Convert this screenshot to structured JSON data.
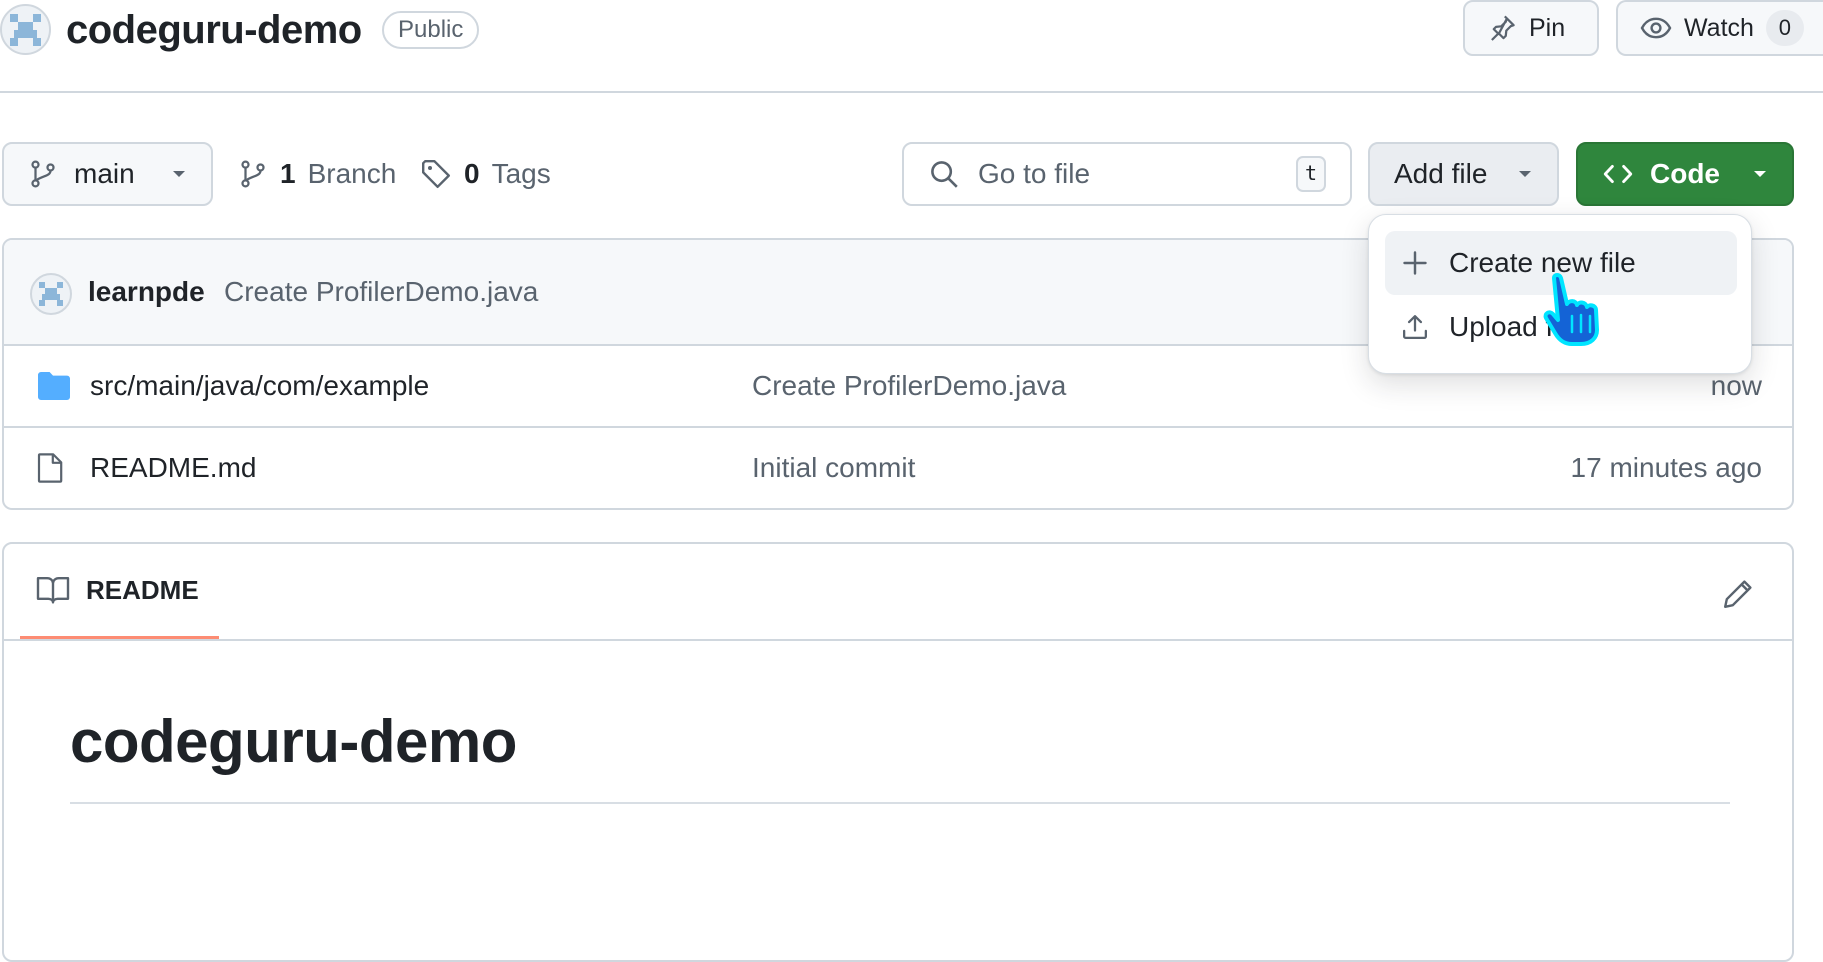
{
  "repo": {
    "name": "codeguru-demo",
    "visibility": "Public",
    "pin_label": "Pin",
    "watch_label": "Watch",
    "watch_count": "0"
  },
  "toolbar": {
    "branch": "main",
    "branches_count": "1",
    "branches_label": "Branch",
    "tags_count": "0",
    "tags_label": "Tags",
    "search_placeholder": "Go to file",
    "search_shortcut": "t",
    "add_file_label": "Add file",
    "code_label": "Code",
    "code_color": "#2f863d"
  },
  "add_file_menu": {
    "items": [
      {
        "label": "Create new file",
        "icon": "plus-icon"
      },
      {
        "label": "Upload files",
        "icon": "upload-icon"
      }
    ]
  },
  "latest_commit": {
    "author": "learnpde",
    "message": "Create ProfilerDemo.java"
  },
  "files": [
    {
      "name": "src/main/java/com/example",
      "type": "folder",
      "icon": "folder-icon",
      "commit": "Create ProfilerDemo.java",
      "age": "now"
    },
    {
      "name": "README.md",
      "type": "file",
      "icon": "file-icon",
      "commit": "Initial commit",
      "age": "17 minutes ago"
    }
  ],
  "readme": {
    "tab_label": "README",
    "heading": "codeguru-demo",
    "accent_color": "#fd8c73"
  }
}
